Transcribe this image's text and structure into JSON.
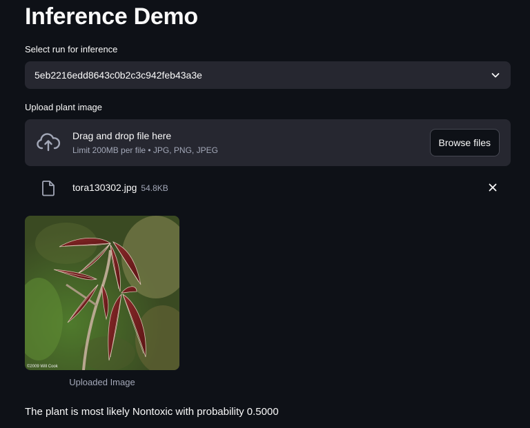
{
  "page": {
    "title": "Inference Demo"
  },
  "run_select": {
    "label": "Select run for inference",
    "value": "5eb2216edd8643c0b2c3c942feb43a3e"
  },
  "uploader": {
    "label": "Upload plant image",
    "drag_text": "Drag and drop file here",
    "limit_text": "Limit 200MB per file • JPG, PNG, JPEG",
    "browse_label": "Browse files"
  },
  "uploaded_file": {
    "name": "tora130302.jpg",
    "size": "54.8KB"
  },
  "image": {
    "caption": "Uploaded Image",
    "watermark": "©2009 Will Cook"
  },
  "result": {
    "text": "The plant is most likely Nontoxic with probability 0.5000"
  },
  "colors": {
    "background": "#0e1117",
    "widget_bg": "#262730",
    "text": "#fafafa",
    "muted_text": "#a3a8b8"
  },
  "icons": {
    "dropdown": "chevron-down-icon",
    "upload": "cloud-upload-icon",
    "file": "file-icon",
    "remove": "close-icon"
  }
}
